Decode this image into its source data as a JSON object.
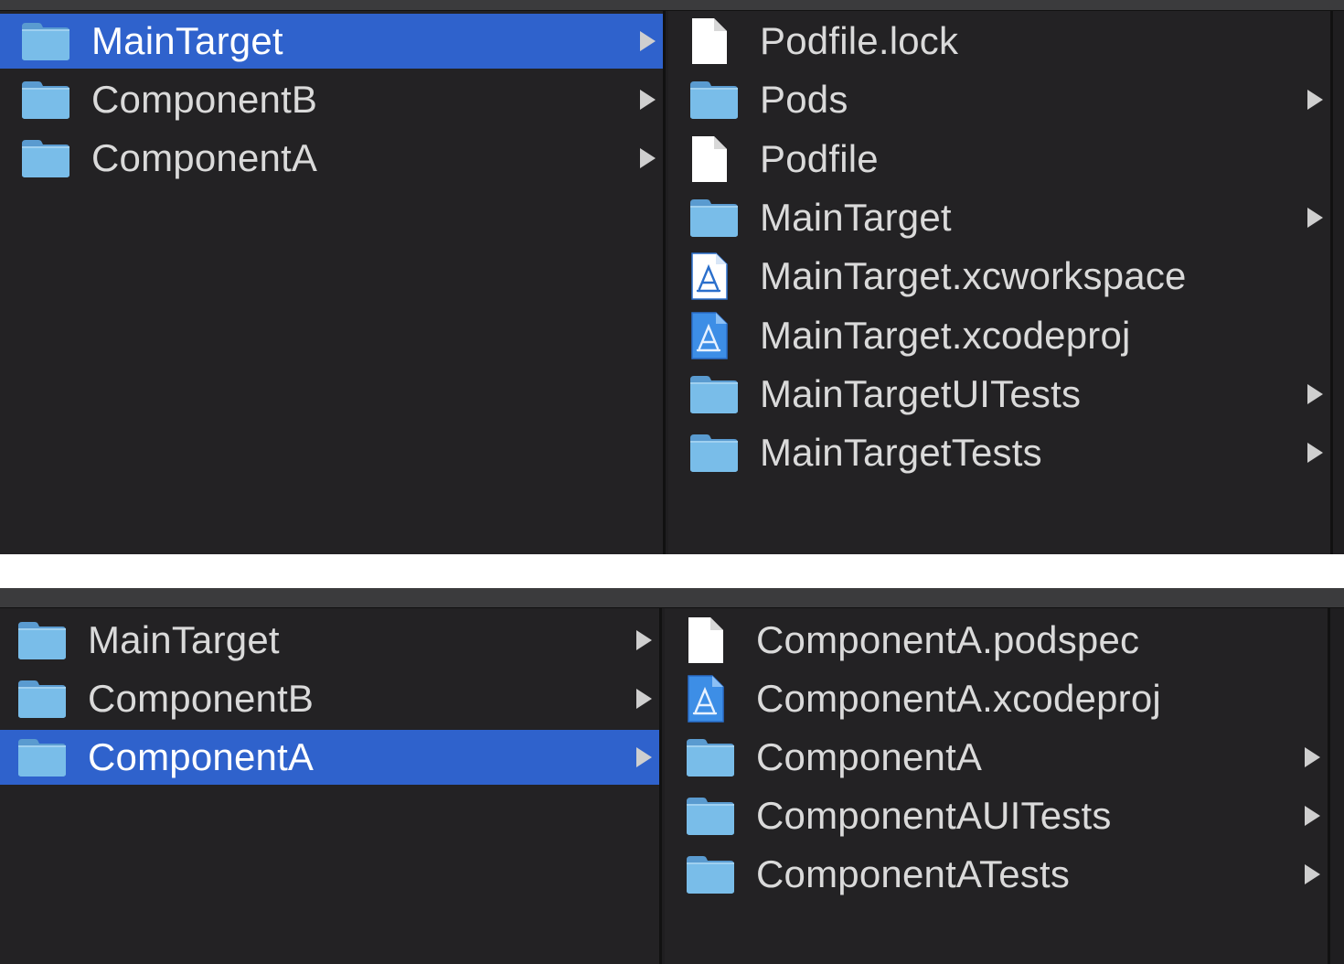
{
  "colors": {
    "background": "#1f1e20",
    "column": "#232224",
    "selection": "#2f62cc",
    "text": "#dadada",
    "folder": "#6cb0e0"
  },
  "top_browser": {
    "left_column": [
      {
        "label": "MainTarget",
        "icon": "folder-icon",
        "selected": true,
        "has_children": true
      },
      {
        "label": "ComponentB",
        "icon": "folder-icon",
        "selected": false,
        "has_children": true
      },
      {
        "label": "ComponentA",
        "icon": "folder-icon",
        "selected": false,
        "has_children": true
      }
    ],
    "right_column": [
      {
        "label": "Podfile.lock",
        "icon": "document-icon",
        "has_children": false
      },
      {
        "label": "Pods",
        "icon": "folder-icon",
        "has_children": true
      },
      {
        "label": "Podfile",
        "icon": "document-icon",
        "has_children": false
      },
      {
        "label": "MainTarget",
        "icon": "folder-icon",
        "has_children": true
      },
      {
        "label": "MainTarget.xcworkspace",
        "icon": "xcworkspace-icon",
        "has_children": false
      },
      {
        "label": "MainTarget.xcodeproj",
        "icon": "xcodeproj-icon",
        "has_children": false
      },
      {
        "label": "MainTargetUITests",
        "icon": "folder-icon",
        "has_children": true
      },
      {
        "label": "MainTargetTests",
        "icon": "folder-icon",
        "has_children": true
      }
    ]
  },
  "bottom_browser": {
    "left_column": [
      {
        "label": "MainTarget",
        "icon": "folder-icon",
        "selected": false,
        "has_children": true
      },
      {
        "label": "ComponentB",
        "icon": "folder-icon",
        "selected": false,
        "has_children": true
      },
      {
        "label": "ComponentA",
        "icon": "folder-icon",
        "selected": true,
        "has_children": true
      }
    ],
    "right_column": [
      {
        "label": "ComponentA.podspec",
        "icon": "document-icon",
        "has_children": false
      },
      {
        "label": "ComponentA.xcodeproj",
        "icon": "xcodeproj-icon",
        "has_children": false
      },
      {
        "label": "ComponentA",
        "icon": "folder-icon",
        "has_children": true
      },
      {
        "label": "ComponentAUITests",
        "icon": "folder-icon",
        "has_children": true
      },
      {
        "label": "ComponentATests",
        "icon": "folder-icon",
        "has_children": true
      }
    ]
  }
}
